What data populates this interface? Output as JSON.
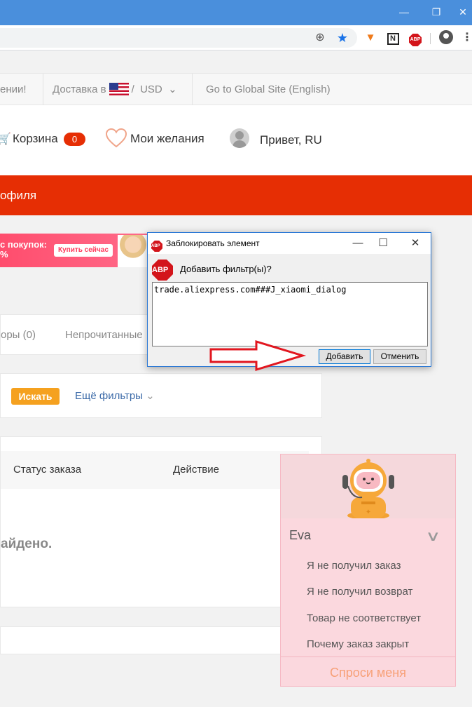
{
  "window": {
    "min_glyph": "—",
    "max_glyph": "❐",
    "close_glyph": "✕"
  },
  "browser": {
    "zoom_glyph": "⊕",
    "star_glyph": "★",
    "brave_glyph": "▼",
    "n_glyph": "N",
    "abp_glyph": "ABP",
    "menu_glyph": "⋮"
  },
  "topbar": {
    "promo_fragment": "ении!",
    "delivery_label": "Доставка в",
    "currency": "USD",
    "currency_caret": "⌄",
    "global_site": "Go to Global Site (English)"
  },
  "header": {
    "cart_label": "Корзина",
    "cart_count": "0",
    "wishlist_label": "Мои желания",
    "greeting": "Привет, RU"
  },
  "profile_bar": {
    "title": "офиля"
  },
  "banner": {
    "text_line1": "с покупок:",
    "text_line2": "%",
    "button": "Купить сейчас"
  },
  "tabs": {
    "tab1": "оры (0)",
    "tab2": "Непрочитанные"
  },
  "search": {
    "button": "Искать",
    "more_filters": "Ещё фильтры",
    "caret": "⌄"
  },
  "orders": {
    "col_status": "Статус заказа",
    "col_action": "Действие",
    "empty_message": "айдено."
  },
  "chat": {
    "name": "Eva",
    "chevron": "∨",
    "items": [
      "Я не получил заказ",
      "Я не получил возврат",
      "Товар не соответствует",
      "Почему заказ закрыт"
    ],
    "ask_me": "Спроси меня"
  },
  "abp_dialog": {
    "icon_text": "ABP",
    "title": "Заблокировать элемент",
    "prompt": "Добавить фильтр(ы)?",
    "filter_text": "trade.aliexpress.com###J_xiaomi_dialog",
    "add_button": "Добавить",
    "cancel_button": "Отменить",
    "min_glyph": "—",
    "max_glyph": "☐",
    "close_glyph": "✕"
  },
  "colors": {
    "accent_red": "#e62e04",
    "search_orange": "#f5a11f",
    "link_blue": "#3b6aa8",
    "arrow_red": "#e2161f"
  }
}
